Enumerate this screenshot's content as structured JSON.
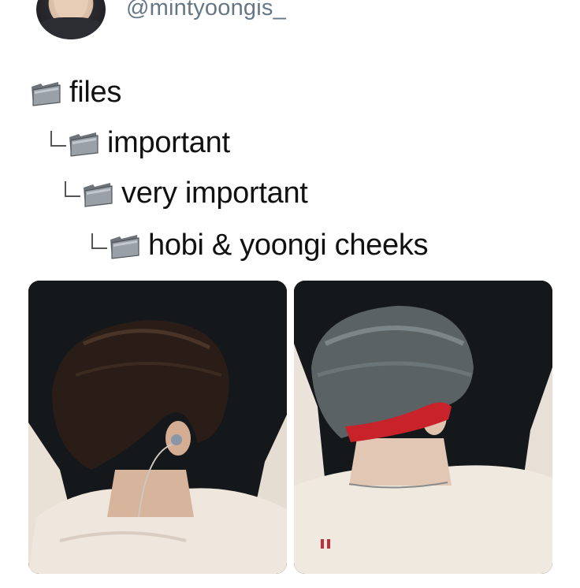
{
  "header": {
    "handle": "@mintyoongis_",
    "avatar_icon": "profile-avatar"
  },
  "tree": {
    "items": [
      {
        "label": "files",
        "depth": 0,
        "icon": "folder-icon"
      },
      {
        "label": "important",
        "depth": 1,
        "icon": "folder-icon"
      },
      {
        "label": "very important",
        "depth": 2,
        "icon": "folder-icon"
      },
      {
        "label": "hobi & yoongi cheeks",
        "depth": 3,
        "icon": "folder-icon"
      }
    ]
  },
  "photos": {
    "left": {
      "subject": "hobi-photo"
    },
    "right": {
      "subject": "yoongi-photo"
    }
  },
  "colors": {
    "handle": "#657786",
    "text": "#111111",
    "headband": "#c8222a",
    "shirt": "#efe6dc",
    "background": "#ffffff"
  }
}
